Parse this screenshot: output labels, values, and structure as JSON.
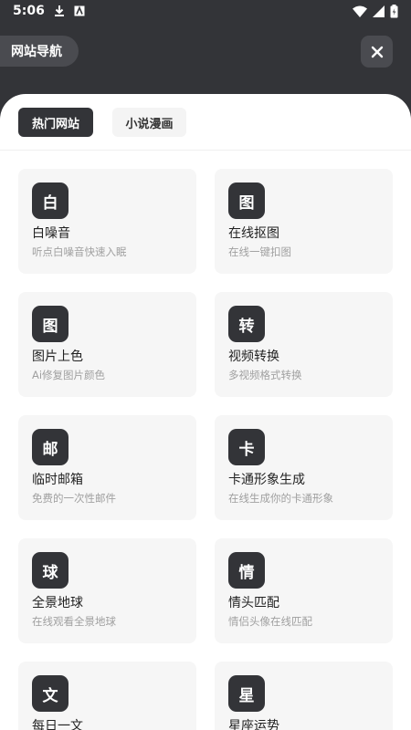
{
  "status_bar": {
    "time": "5:06",
    "icons": [
      "download-icon",
      "a-badge-icon",
      "wifi-icon",
      "signal-icon",
      "battery-icon"
    ]
  },
  "header": {
    "nav_label": "网站导航",
    "close_icon": "close-icon"
  },
  "tabs": [
    {
      "label": "热门网站",
      "active": true
    },
    {
      "label": "小说漫画",
      "active": false
    }
  ],
  "cards": [
    {
      "icon_char": "白",
      "title": "白噪音",
      "desc": "听点白噪音快速入眠"
    },
    {
      "icon_char": "图",
      "title": "在线抠图",
      "desc": "在线一键扣图"
    },
    {
      "icon_char": "图",
      "title": "图片上色",
      "desc": "Ai修复图片颜色"
    },
    {
      "icon_char": "转",
      "title": "视频转换",
      "desc": "多视频格式转换"
    },
    {
      "icon_char": "邮",
      "title": "临时邮箱",
      "desc": "免费的一次性邮件"
    },
    {
      "icon_char": "卡",
      "title": "卡通形象生成",
      "desc": "在线生成你的卡通形象"
    },
    {
      "icon_char": "球",
      "title": "全景地球",
      "desc": "在线观看全景地球"
    },
    {
      "icon_char": "情",
      "title": "情头匹配",
      "desc": "情侣头像在线匹配"
    },
    {
      "icon_char": "文",
      "title": "每日一文",
      "desc": ""
    },
    {
      "icon_char": "星",
      "title": "星座运势",
      "desc": ""
    }
  ],
  "colors": {
    "background": "#333438",
    "sheet": "#ffffff",
    "card": "#f6f6f6",
    "accent": "#333438"
  }
}
